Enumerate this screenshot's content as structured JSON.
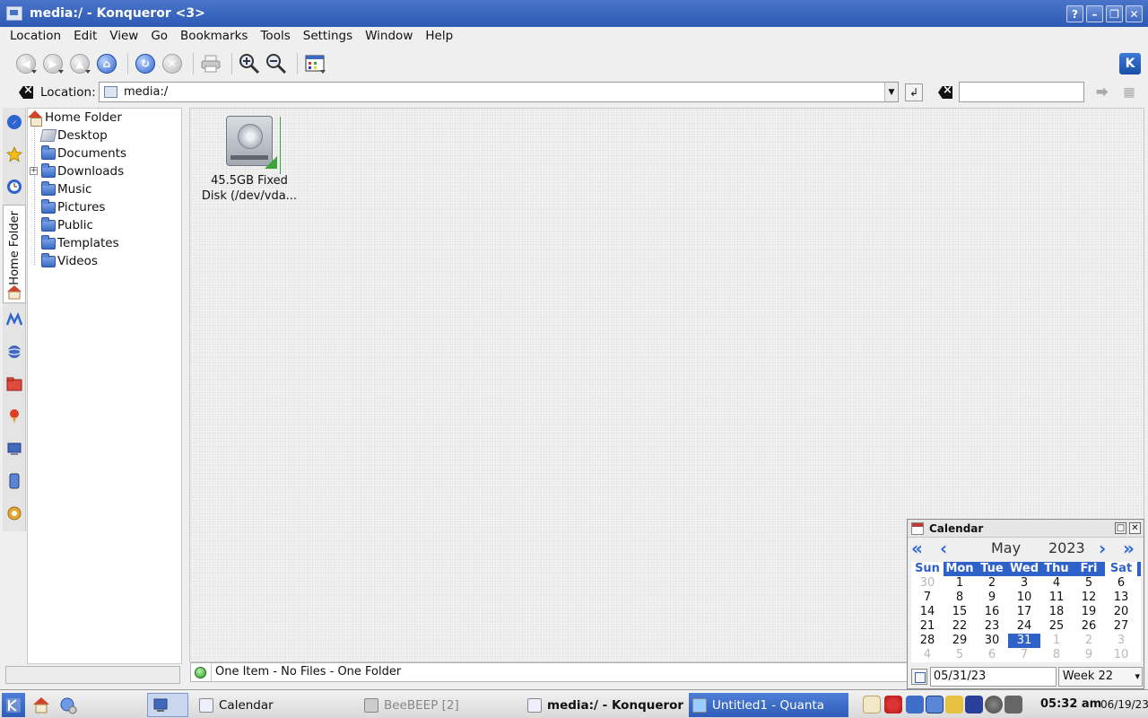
{
  "window": {
    "title": "media:/ - Konqueror <3>",
    "buttons": [
      "?",
      "–",
      "❐",
      "✕"
    ]
  },
  "menubar": {
    "items": [
      {
        "label": "Location"
      },
      {
        "label": "Edit"
      },
      {
        "label": "View"
      },
      {
        "label": "Go"
      },
      {
        "label": "Bookmarks"
      },
      {
        "label": "Tools"
      },
      {
        "label": "Settings"
      },
      {
        "label": "Window"
      },
      {
        "label": "Help"
      }
    ]
  },
  "toolbar": {
    "kde_logo": "K",
    "icons": [
      "back-icon",
      "forward-icon",
      "up-icon",
      "home-icon",
      "reload-icon",
      "stop-icon",
      "print-icon",
      "zoom-in-icon",
      "zoom-out-icon",
      "view-mode-icon"
    ]
  },
  "location": {
    "label": "Location:",
    "value": "media:/"
  },
  "sidebar": {
    "vertical_tab_label": "Home Folder",
    "tree": [
      {
        "label": "Home Folder",
        "icon": "home-icon"
      },
      {
        "label": "Desktop",
        "icon": "desktop-icon"
      },
      {
        "label": "Documents",
        "icon": "folder-icon"
      },
      {
        "label": "Downloads",
        "icon": "folder-icon",
        "expandable": true
      },
      {
        "label": "Music",
        "icon": "folder-icon"
      },
      {
        "label": "Pictures",
        "icon": "folder-icon"
      },
      {
        "label": "Public",
        "icon": "folder-icon"
      },
      {
        "label": "Templates",
        "icon": "folder-icon"
      },
      {
        "label": "Videos",
        "icon": "folder-icon"
      }
    ]
  },
  "main": {
    "items": [
      {
        "label_line1": "45.5GB Fixed",
        "label_line2": "Disk (/dev/vda...",
        "icon": "hard-disk-icon"
      }
    ]
  },
  "status": {
    "text": "One Item - No Files - One Folder"
  },
  "calendar": {
    "title": "Calendar",
    "month": "May",
    "year": "2023",
    "weekdays": [
      "Sun",
      "Mon",
      "Tue",
      "Wed",
      "Thu",
      "Fri",
      "Sat"
    ],
    "weeks": [
      [
        "30",
        "1",
        "2",
        "3",
        "4",
        "5",
        "6"
      ],
      [
        "7",
        "8",
        "9",
        "10",
        "11",
        "12",
        "13"
      ],
      [
        "14",
        "15",
        "16",
        "17",
        "18",
        "19",
        "20"
      ],
      [
        "21",
        "22",
        "23",
        "24",
        "25",
        "26",
        "27"
      ],
      [
        "28",
        "29",
        "30",
        "31",
        "1",
        "2",
        "3"
      ],
      [
        "4",
        "5",
        "6",
        "7",
        "8",
        "9",
        "10"
      ]
    ],
    "selected": "31",
    "date_field": "05/31/23",
    "week_label": "Week 22"
  },
  "taskbar": {
    "tasks": [
      {
        "label": "Calendar"
      },
      {
        "label": "BeeBEEP [2]"
      },
      {
        "label": "media:/ - Konqueror"
      },
      {
        "label": "Untitled1 - Quanta"
      }
    ],
    "clock": "05:32 am",
    "date": "06/19/23"
  }
}
